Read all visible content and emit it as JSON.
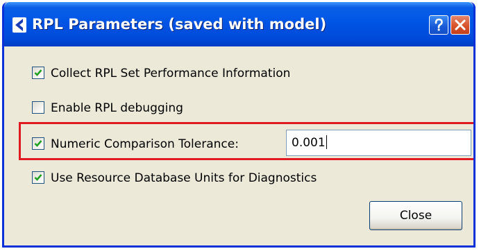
{
  "window": {
    "title": "RPL Parameters (saved with model)",
    "icons": {
      "app": "rpl-app-icon",
      "help": "help-icon",
      "close": "close-icon"
    }
  },
  "options": [
    {
      "label": "Collect RPL Set Performance Information",
      "checked": true
    },
    {
      "label": "Enable RPL debugging",
      "checked": false
    },
    {
      "label": "Numeric Comparison Tolerance:",
      "checked": true
    },
    {
      "label": "Use Resource Database Units for Diagnostics",
      "checked": true
    }
  ],
  "tolerance": {
    "value": "0.001"
  },
  "buttons": {
    "close_label": "Close"
  },
  "colors": {
    "title_bar": "#0055e5",
    "dialog_bg": "#ece9d8",
    "highlight": "#e11a21",
    "checkmark": "#21a121"
  }
}
